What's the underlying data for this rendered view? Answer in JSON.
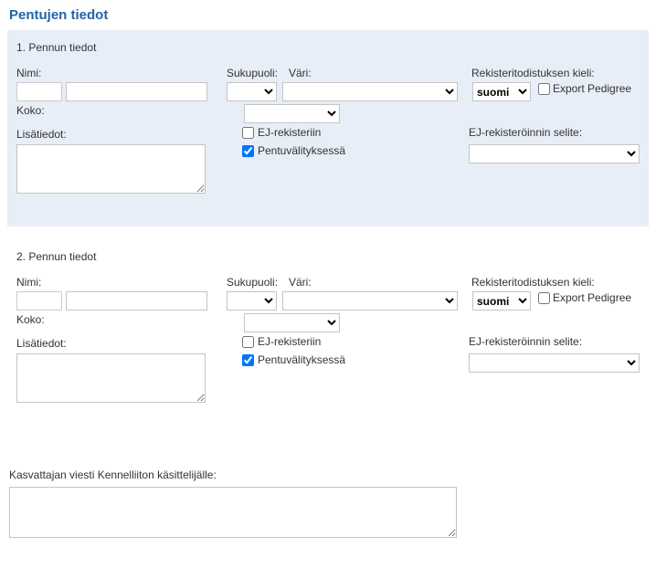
{
  "page_title": "Pentujen tiedot",
  "labels": {
    "nimi": "Nimi:",
    "sukupuoli": "Sukupuoli:",
    "vari": "Väri:",
    "rek_kieli": "Rekisteritodistuksen kieli:",
    "export_pedigree": "Export Pedigree",
    "koko": "Koko:",
    "lisatiedot": "Lisätiedot:",
    "ej_rekisteriin": "EJ-rekisteriin",
    "pentuvalityksessa": "Pentuvälityksessä",
    "ej_selite": "EJ-rekisteröinnin selite:",
    "breeder_msg": "Kasvattajan viesti Kennelliiton käsittelijälle:"
  },
  "lang_options": [
    "suomi"
  ],
  "puppies": [
    {
      "index_title": "1. Pennun tiedot",
      "name": "",
      "sex": "",
      "color": "",
      "lang": "suomi",
      "export_pedigree": false,
      "size": "",
      "lisatiedot": "",
      "ej_rekisteriin": false,
      "pentuvalityksessa": true,
      "ej_selite": ""
    },
    {
      "index_title": "2. Pennun tiedot",
      "name": "",
      "sex": "",
      "color": "",
      "lang": "suomi",
      "export_pedigree": false,
      "size": "",
      "lisatiedot": "",
      "ej_rekisteriin": false,
      "pentuvalityksessa": true,
      "ej_selite": ""
    }
  ],
  "breeder_message": ""
}
